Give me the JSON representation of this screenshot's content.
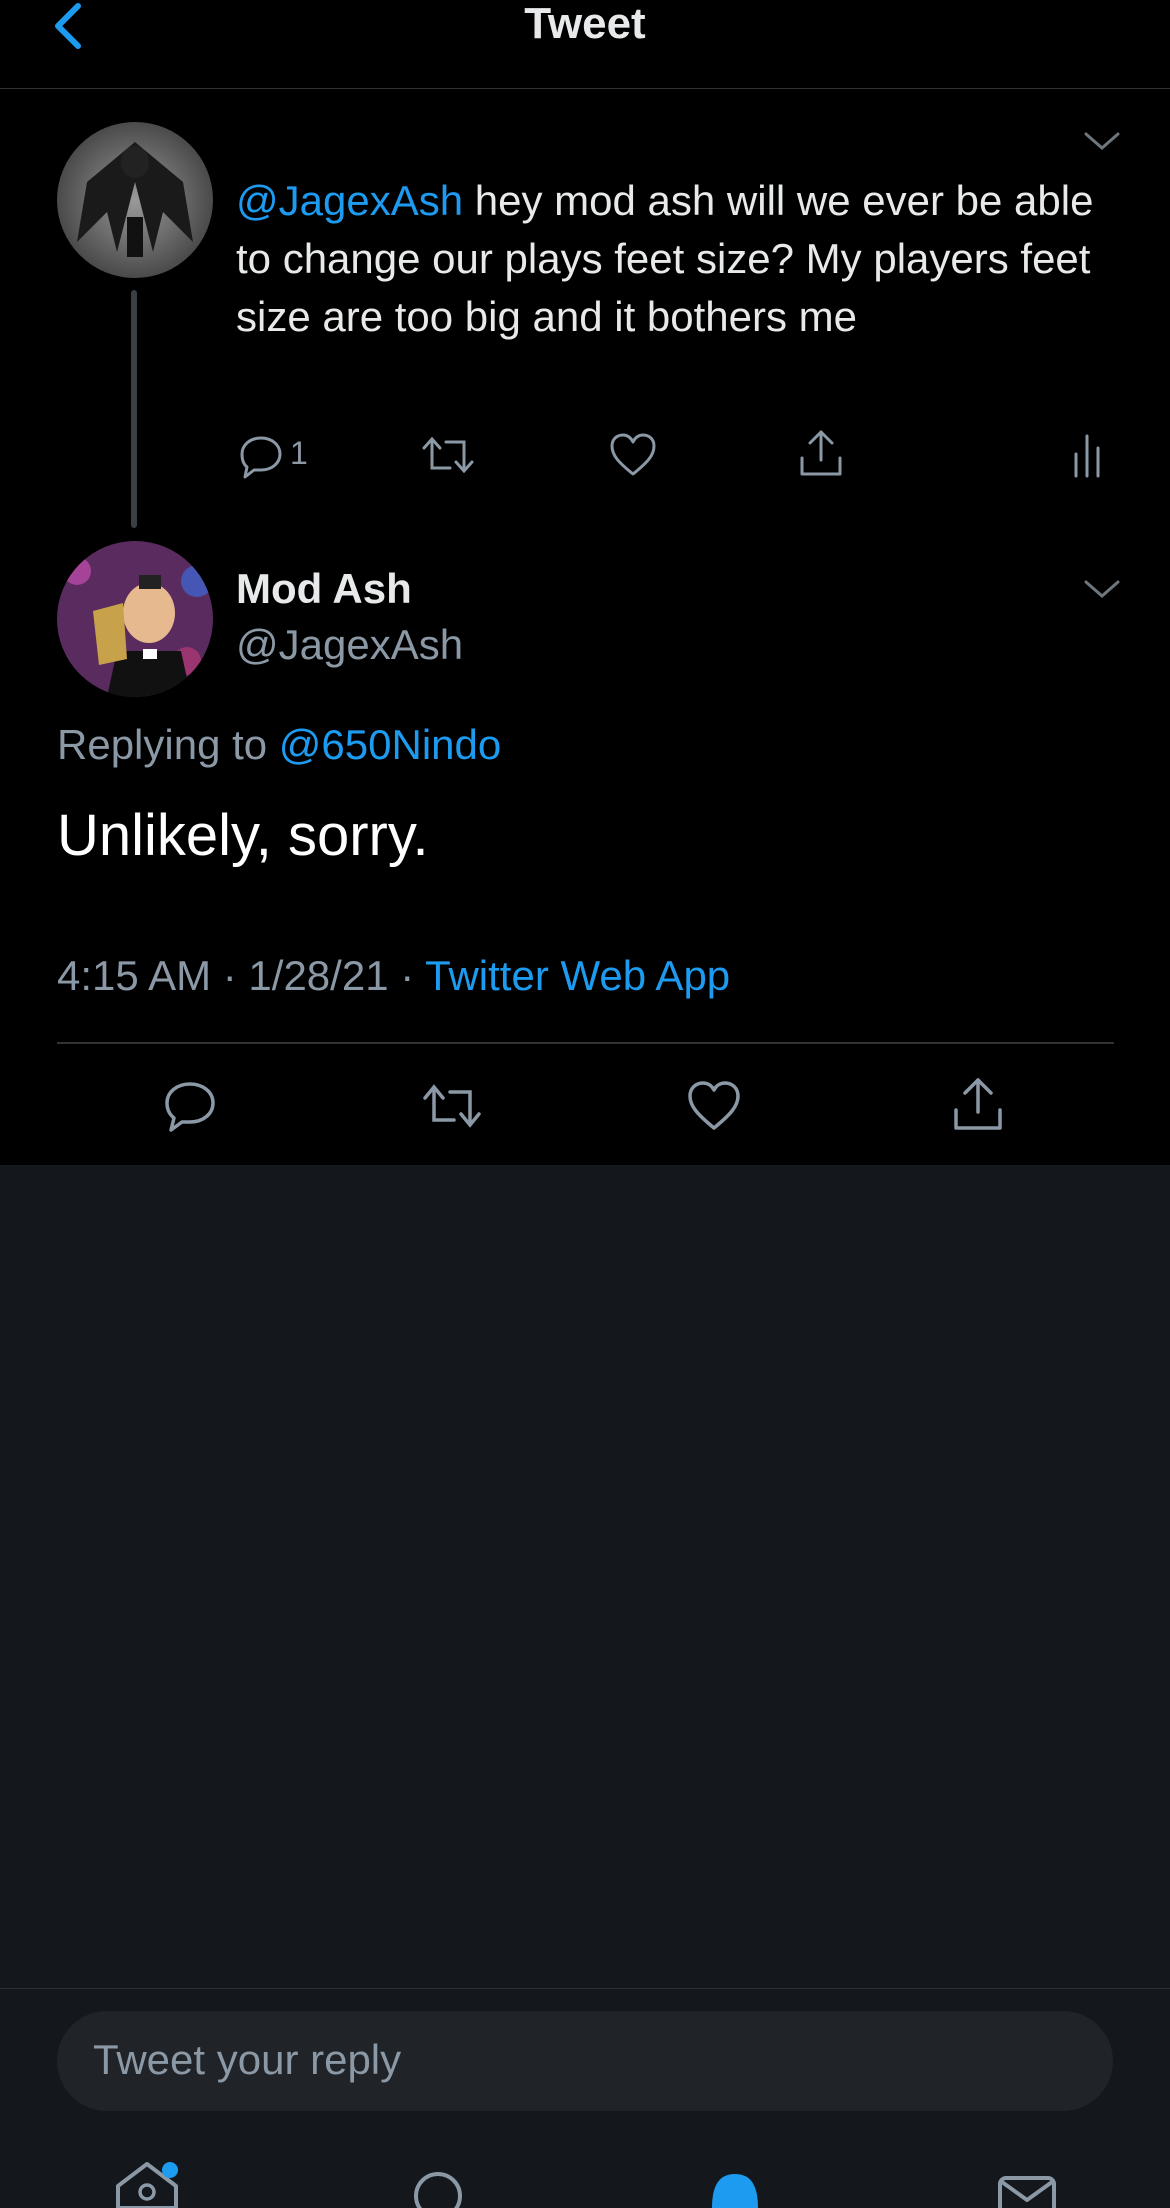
{
  "header": {
    "title": "Tweet"
  },
  "parent_tweet": {
    "segments": {
      "mention": "@JagexAsh",
      "text": " hey mod ash will we ever be able to change our plays feet size? My players feet size are too big and it bothers me"
    },
    "reply_count": "1"
  },
  "main_tweet": {
    "name": "Mod Ash",
    "handle": "@JagexAsh",
    "replying_prefix": "Replying to",
    "replying_handle": "@650Nindo",
    "body": "Unlikely, sorry.",
    "time": "4:15 AM · 1/28/21 · ",
    "source": "Twitter Web App"
  },
  "reply_composer": {
    "placeholder": "Tweet your reply"
  },
  "colors": {
    "accent": "#1d9bf0",
    "background_top": "#000000",
    "background_bottom": "#14171c",
    "muted": "#8b98a5"
  }
}
